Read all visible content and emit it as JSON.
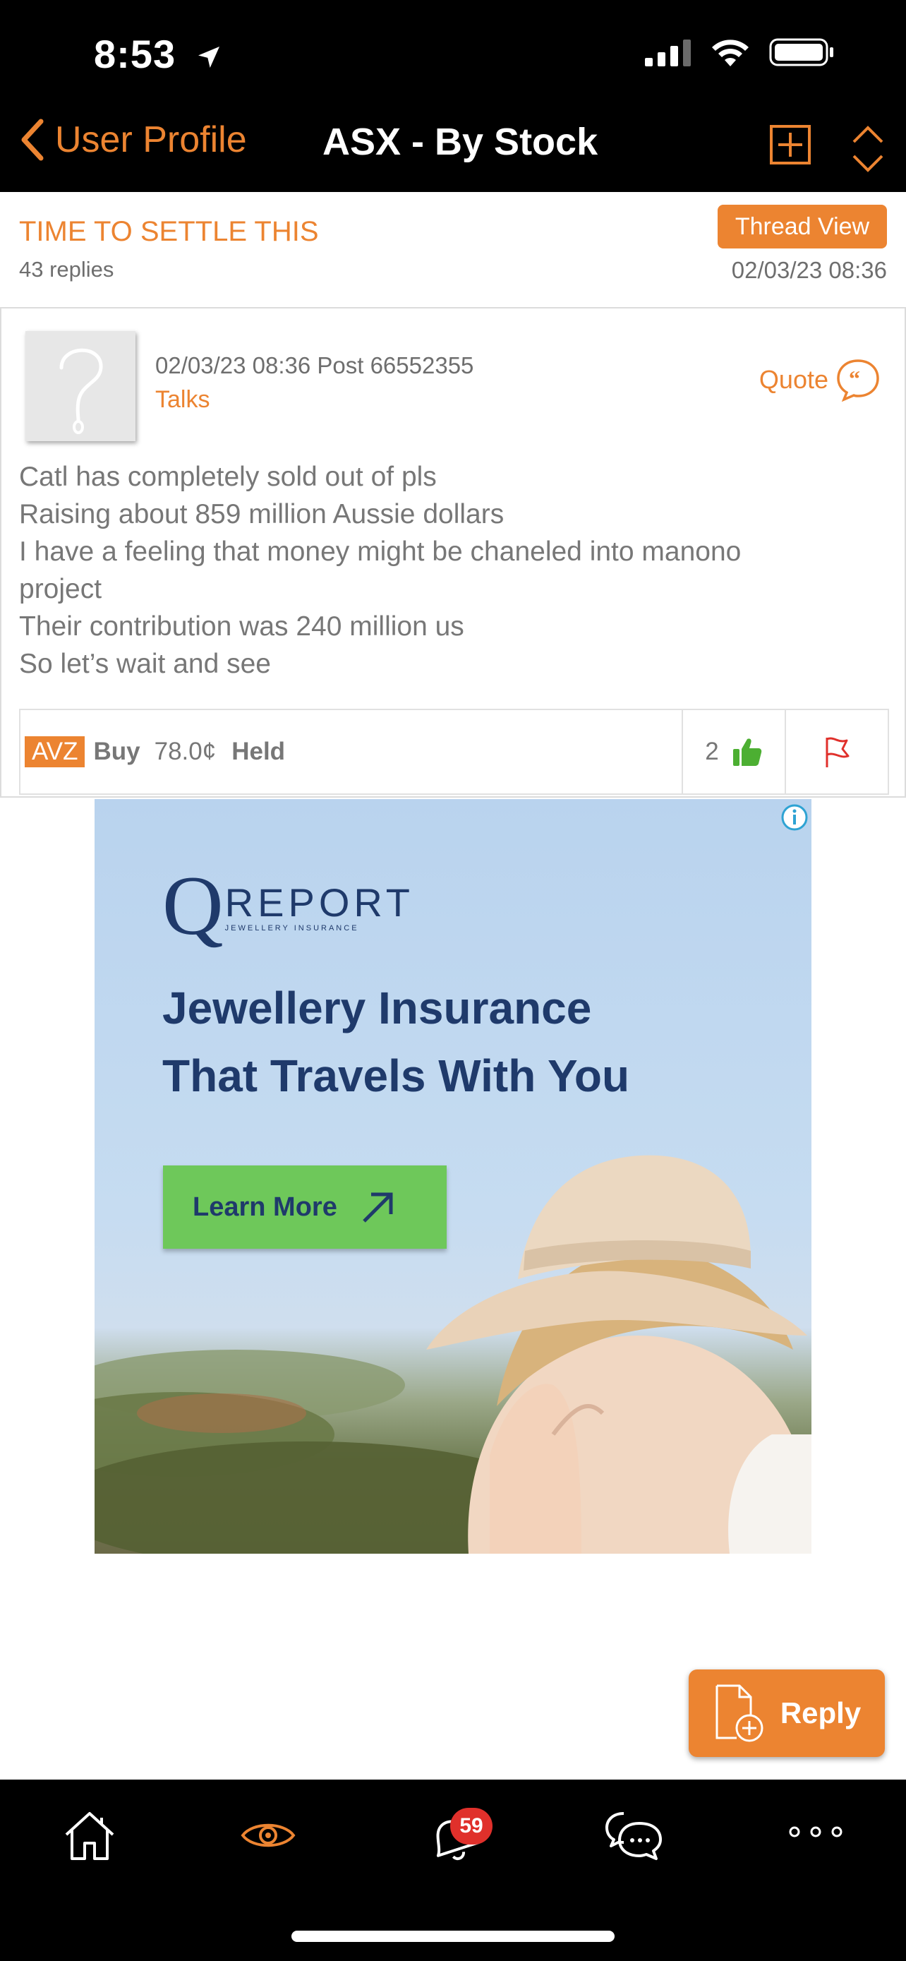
{
  "status_bar": {
    "time": "8:53"
  },
  "nav": {
    "back_label": "User Profile",
    "title": "ASX - By Stock"
  },
  "thread": {
    "title": "TIME TO SETTLE THIS",
    "replies": "43 replies",
    "view_button": "Thread View",
    "date": "02/03/23 08:36"
  },
  "post": {
    "meta": "02/03/23 08:36 Post  66552355",
    "author": "Talks",
    "quote_label": "Quote",
    "body_lines": [
      "Catl has completely sold out of pls",
      "Raising about 859 million Aussie dollars",
      "I have a feeling that money might be chaneled into manono",
      "project",
      "Their contribution was 240 million us",
      "So let’s wait and see"
    ],
    "ticker": "AVZ",
    "sentiment": "Buy",
    "price": "78.0¢",
    "disclosure": "Held",
    "likes": "2"
  },
  "ad": {
    "logo_q": "Q",
    "logo_word": "REPORT",
    "logo_tagline": "JEWELLERY INSURANCE",
    "headline_line1": "Jewellery Insurance",
    "headline_line2": "That Travels With You",
    "cta_label": "Learn More"
  },
  "reply_button": "Reply",
  "tabbar": {
    "notifications_count": "59"
  },
  "colors": {
    "accent": "#ec8431",
    "like_green": "#4caf32",
    "flag_red": "#e0302b"
  }
}
